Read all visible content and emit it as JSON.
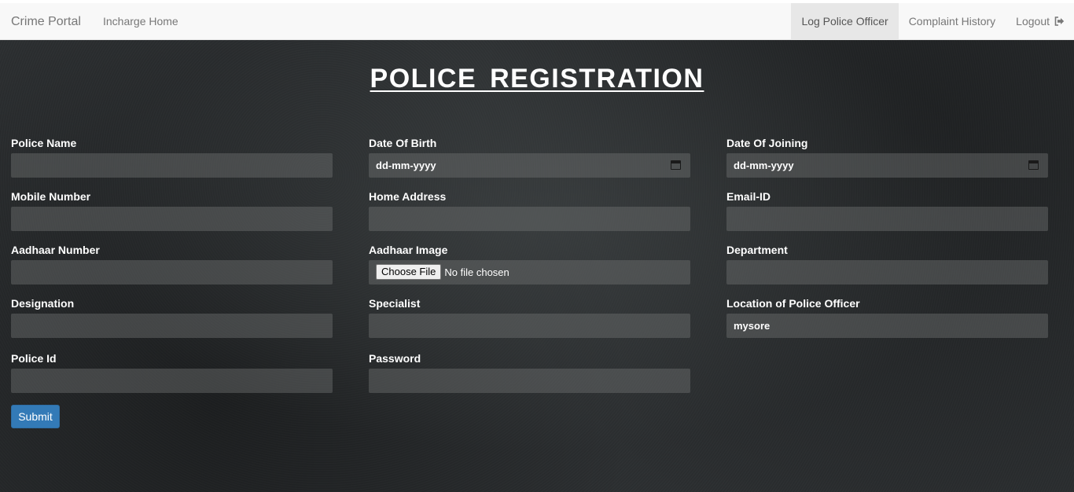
{
  "navbar": {
    "brand": "Crime Portal",
    "left_link": "Incharge Home",
    "right_links": [
      "Log Police Officer",
      "Complaint History",
      "Logout"
    ]
  },
  "form": {
    "title": "POLICE REGISTRATION",
    "fields": {
      "police_name": {
        "label": "Police Name",
        "value": ""
      },
      "date_of_birth": {
        "label": "Date Of Birth",
        "value": "dd-mm-yyyy"
      },
      "date_of_joining": {
        "label": "Date Of Joining",
        "value": "dd-mm-yyyy"
      },
      "mobile_number": {
        "label": "Mobile Number",
        "value": ""
      },
      "home_address": {
        "label": "Home Address",
        "value": ""
      },
      "email_id": {
        "label": "Email-ID",
        "value": ""
      },
      "aadhaar_number": {
        "label": "Aadhaar Number",
        "value": ""
      },
      "aadhaar_image": {
        "label": "Aadhaar Image",
        "button": "Choose File",
        "status": "No file chosen"
      },
      "department": {
        "label": "Department",
        "value": ""
      },
      "designation": {
        "label": "Designation",
        "value": ""
      },
      "specialist": {
        "label": "Specialist",
        "value": ""
      },
      "location": {
        "label": "Location of Police Officer",
        "value": "mysore"
      },
      "police_id": {
        "label": "Police Id",
        "value": ""
      },
      "password": {
        "label": "Password",
        "value": ""
      }
    },
    "submit": "Submit"
  },
  "colors": {
    "navbar_bg": "#f8f8f8",
    "active_nav_bg": "#e7e7e7",
    "page_bg": "#2b2e30",
    "submit_bg": "#337ab7"
  },
  "icons": [
    "logout-icon",
    "calendar-icon"
  ]
}
